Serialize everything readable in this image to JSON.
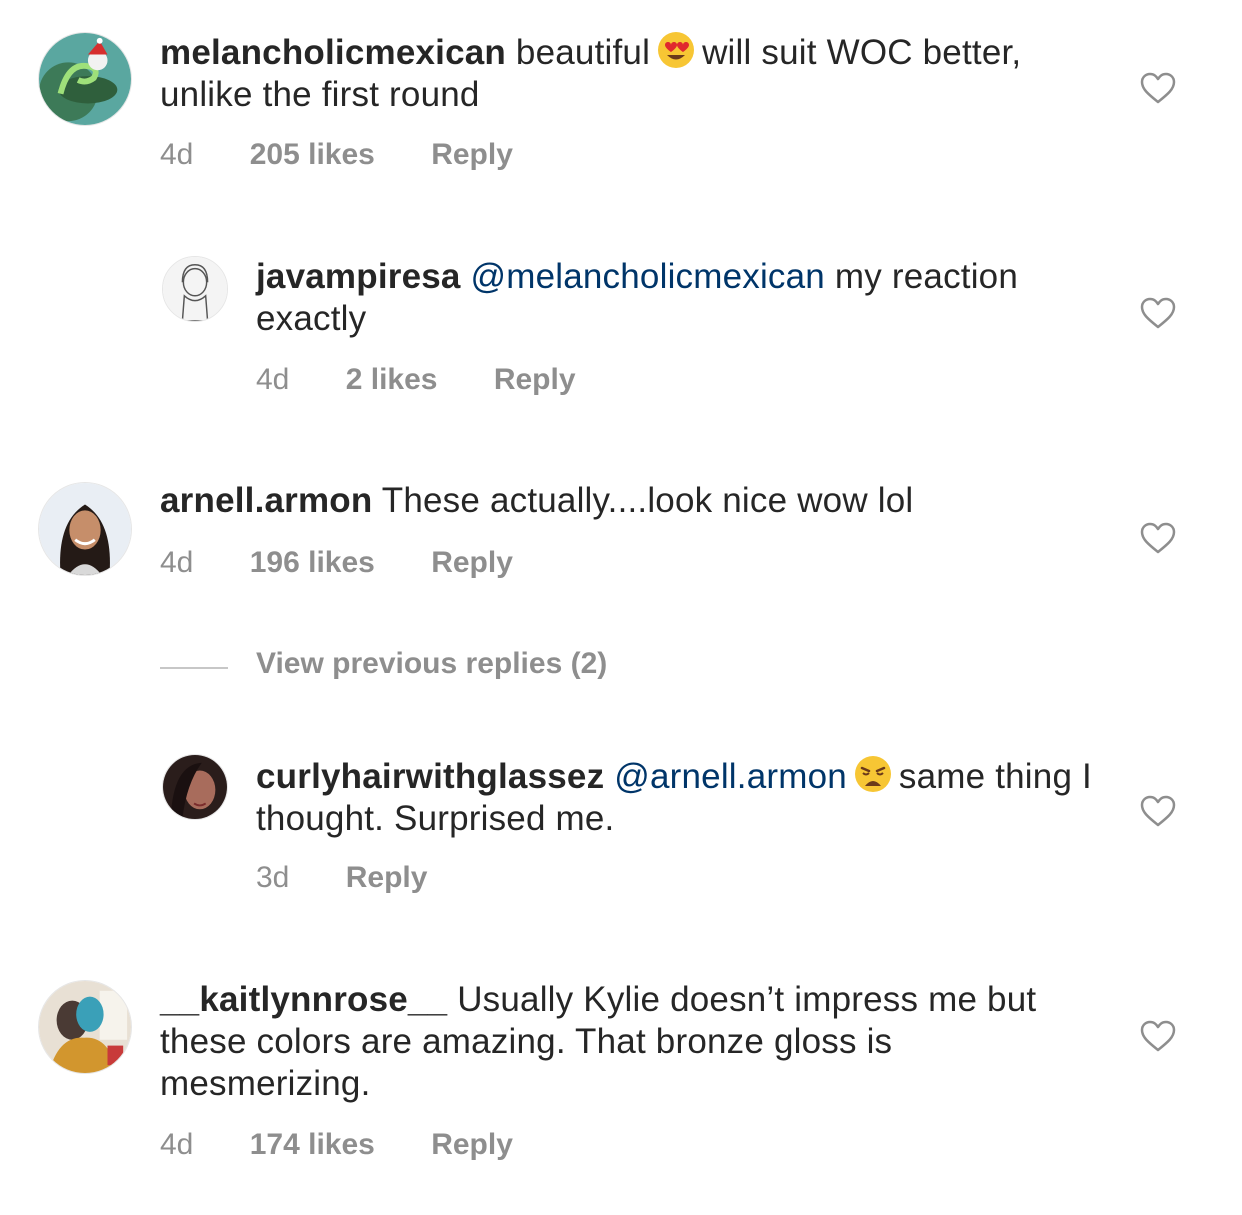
{
  "comments": [
    {
      "username": "melancholicmexican",
      "text_part1": "beautiful",
      "emoji": "heart-eyes-emoji",
      "text_part2": "will suit WOC better, unlike the first round",
      "time": "4d",
      "likes": "205 likes",
      "reply": "Reply"
    },
    {
      "username": "javampiresa",
      "mention": "@melancholicmexican",
      "text": "my reaction exactly",
      "time": "4d",
      "likes": "2 likes",
      "reply": "Reply"
    },
    {
      "username": "arnell.armon",
      "text": "These actually....look nice wow lol",
      "time": "4d",
      "likes": "196 likes",
      "reply": "Reply"
    },
    {
      "username": "curlyhairwithglassez",
      "mention": "@arnell.armon",
      "emoji": "weary-face-emoji",
      "text": "same thing I thought. Surprised me.",
      "time": "3d",
      "reply": "Reply"
    },
    {
      "username": "__kaitlynnrose__",
      "text": "Usually Kylie doesn’t impress me but these colors are amazing. That bronze gloss is mesmerizing.",
      "time": "4d",
      "likes": "174 likes",
      "reply": "Reply"
    }
  ],
  "view_previous_replies": "View previous replies (2)",
  "colors": {
    "text": "#262626",
    "meta": "#8e8e8e",
    "mention": "#003569",
    "background": "#ffffff"
  }
}
